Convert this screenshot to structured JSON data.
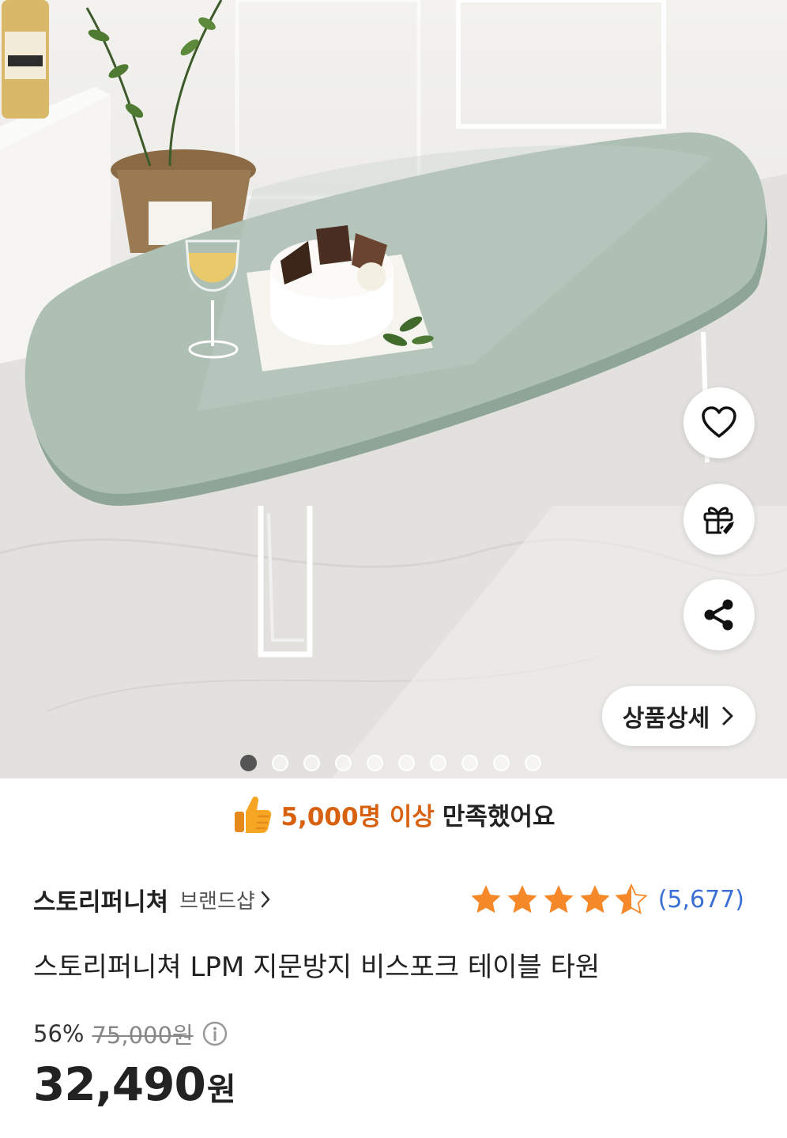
{
  "actions": {
    "like_icon": "heart-icon",
    "gift_icon": "gift-icon",
    "share_icon": "share-icon",
    "detail_label": "상품상세"
  },
  "carousel": {
    "total": 10,
    "active_index": 0
  },
  "satisfaction": {
    "highlight": "5,000명 이상",
    "rest": "만족했어요"
  },
  "brand": {
    "name": "스토리퍼니쳐",
    "shop_label": "브랜드샵"
  },
  "rating": {
    "stars": 4.5,
    "count": "(5,677)",
    "star_color": "#f5892a"
  },
  "product": {
    "title": "스토리퍼니쳐 LPM 지문방지 비스포크 테이블 타원"
  },
  "pricing": {
    "discount": "56%",
    "original": "75,000원",
    "price": "32,490",
    "unit": "원"
  },
  "colors": {
    "accent_orange": "#d8610f",
    "link_blue": "#3b6fd6"
  }
}
